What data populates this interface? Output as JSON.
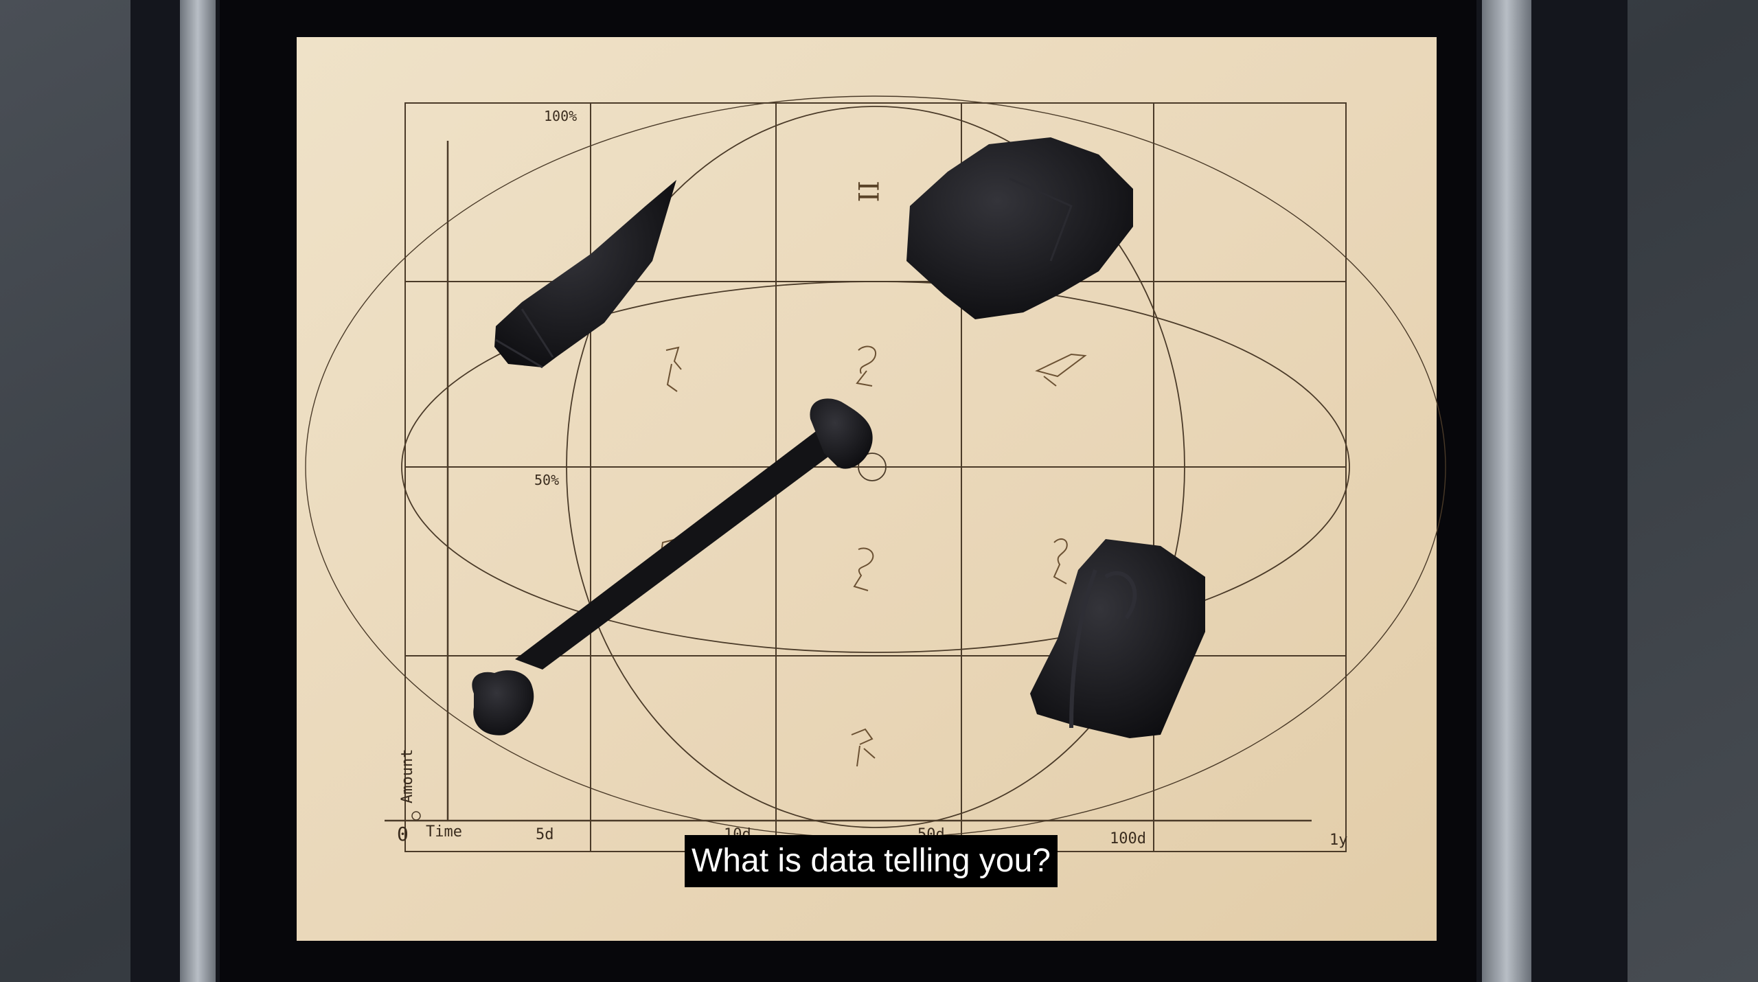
{
  "board": {
    "y_axis": {
      "label": "Amount",
      "ticks": [
        "100%",
        "50%"
      ]
    },
    "x_axis": {
      "label": "Time",
      "origin": "0",
      "ticks": [
        "5d",
        "10d",
        "50d",
        "100d",
        "1y"
      ]
    },
    "glyphs": [
      "II"
    ]
  },
  "objects": [
    {
      "name": "arrowhead",
      "color": "#1c1c20"
    },
    {
      "name": "rock",
      "color": "#18181b"
    },
    {
      "name": "bone",
      "color": "#141417"
    },
    {
      "name": "pouch",
      "color": "#1a1a1d"
    }
  ],
  "caption": {
    "text": "What is data telling you?"
  },
  "colors": {
    "board": "#ead8ba",
    "lines": "#4a3a28",
    "frame": "#0b0b10",
    "floor": "#3d4248"
  }
}
